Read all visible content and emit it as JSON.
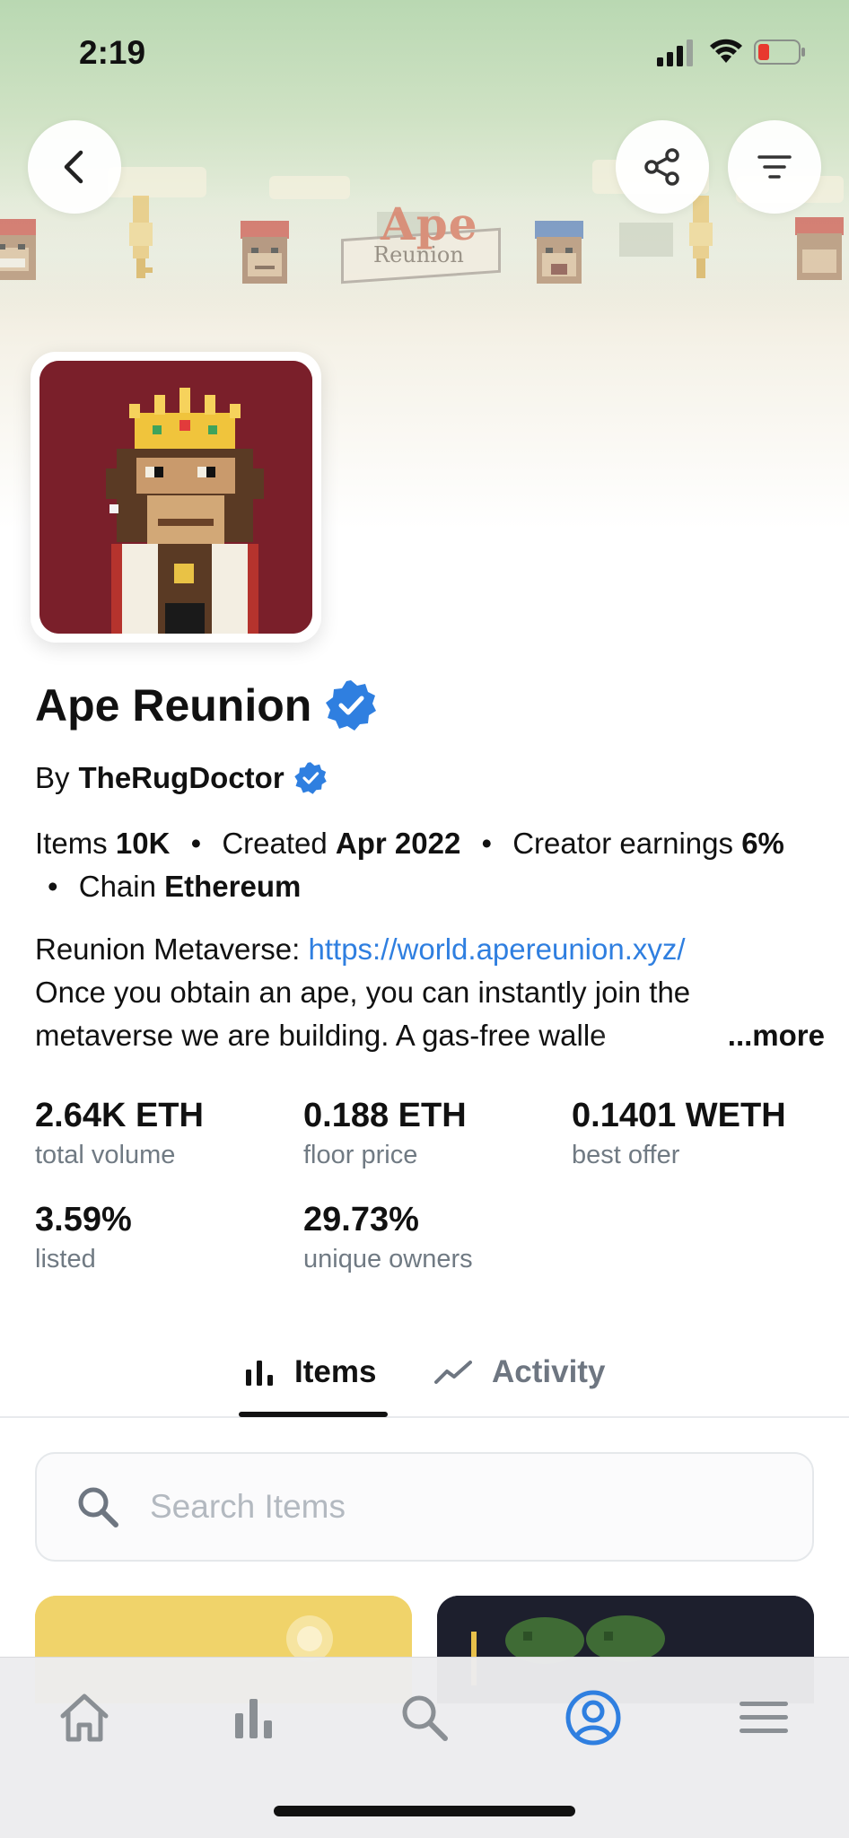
{
  "status_bar": {
    "time": "2:19"
  },
  "banner": {
    "logo_ape": "Ape",
    "logo_reunion": "Reunion"
  },
  "collection": {
    "title": "Ape Reunion",
    "by_prefix": "By",
    "creator": "TheRugDoctor",
    "meta": {
      "items_label": "Items",
      "items_value": "10K",
      "created_label": "Created",
      "created_value": "Apr 2022",
      "earnings_label": "Creator earnings",
      "earnings_value": "6%",
      "chain_label": "Chain",
      "chain_value": "Ethereum",
      "separator": "•"
    },
    "description": {
      "prefix": "Reunion Metaverse: ",
      "link": "https://world.apereunion.xyz/",
      "line2": "Once you obtain an ape, you can instantly join the",
      "line3": "metaverse we are building. A gas-free walle",
      "more": "...more"
    }
  },
  "stats": [
    {
      "value": "2.64K ETH",
      "label": "total volume"
    },
    {
      "value": "0.188 ETH",
      "label": "floor price"
    },
    {
      "value": "0.1401 WETH",
      "label": "best offer"
    },
    {
      "value": "3.59%",
      "label": "listed"
    },
    {
      "value": "29.73%",
      "label": "unique owners"
    }
  ],
  "tabs": [
    {
      "label": "Items",
      "icon": "bar-chart-icon",
      "active": true
    },
    {
      "label": "Activity",
      "icon": "trend-line-icon",
      "active": false
    }
  ],
  "search": {
    "placeholder": "Search Items",
    "value": ""
  },
  "bottom_nav": [
    {
      "icon": "home-icon"
    },
    {
      "icon": "stats-icon"
    },
    {
      "icon": "search-icon"
    },
    {
      "icon": "profile-icon",
      "active": true
    },
    {
      "icon": "menu-icon"
    }
  ],
  "colors": {
    "link": "#2f7fe0",
    "verified": "#2f7fe0",
    "active_nav": "#2f7fe0",
    "muted_text": "#707a83",
    "avatar_bg": "#7a1f2a"
  }
}
